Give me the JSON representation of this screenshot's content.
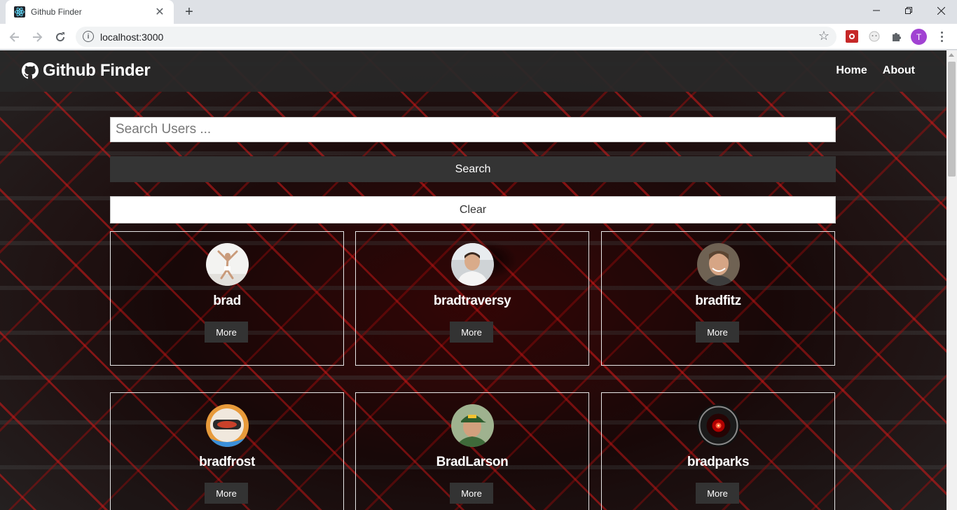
{
  "browser": {
    "tab_title": "Github Finder",
    "url": "localhost:3000",
    "profile_initial": "T"
  },
  "app": {
    "brand_title": "Github Finder",
    "nav": [
      {
        "label": "Home"
      },
      {
        "label": "About"
      }
    ],
    "search": {
      "placeholder": "Search Users ...",
      "value": "",
      "search_label": "Search",
      "clear_label": "Clear"
    },
    "users": [
      {
        "login": "brad",
        "more_label": "More",
        "avatar": "person-jumping-avatar"
      },
      {
        "login": "bradtraversy",
        "more_label": "More",
        "avatar": "man-portrait-avatar"
      },
      {
        "login": "bradfitz",
        "more_label": "More",
        "avatar": "man-smiling-avatar"
      },
      {
        "login": "bradfrost",
        "more_label": "More",
        "avatar": "helmet-avatar"
      },
      {
        "login": "BradLarson",
        "more_label": "More",
        "avatar": "man-cap-avatar"
      },
      {
        "login": "bradparks",
        "more_label": "More",
        "avatar": "hal-eye-avatar"
      }
    ]
  },
  "colors": {
    "navbar": "#282828",
    "button_dark": "#343434",
    "text_light": "#ffffff",
    "accent_red": "#d71919"
  }
}
